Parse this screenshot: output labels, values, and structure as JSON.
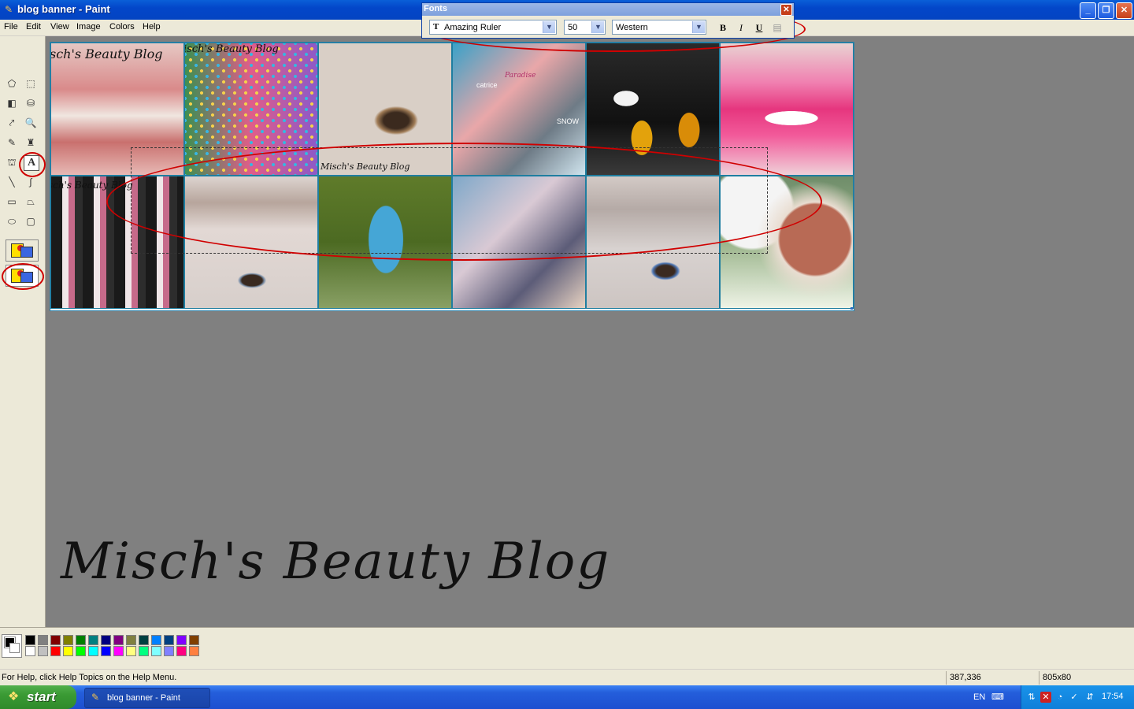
{
  "window": {
    "title": "blog banner - Paint"
  },
  "menu": {
    "file": "File",
    "edit": "Edit",
    "view": "View",
    "image": "Image",
    "colors": "Colors",
    "help": "Help"
  },
  "fonts_toolbar": {
    "title": "Fonts",
    "font_name": "Amazing Ruler",
    "font_size": "50",
    "script": "Western",
    "bold": "B",
    "italic": "I",
    "underline": "U"
  },
  "canvas": {
    "watermark": "Misch's Beauty Blog",
    "watermark_cut_1": "isch's Beauty Blog",
    "watermark_cut_2": "sch's Beauty Blog",
    "tile_labels": [
      "catrice",
      "Paradise",
      "SNOW"
    ],
    "big_text": "Misch's Beauty Blog"
  },
  "palette": {
    "top_row": [
      "#000000",
      "#808080",
      "#800000",
      "#808000",
      "#008000",
      "#008080",
      "#000080",
      "#800080",
      "#808040",
      "#004040",
      "#0080ff",
      "#004080",
      "#8000ff",
      "#804000"
    ],
    "bottom_row": [
      "#ffffff",
      "#c0c0c0",
      "#ff0000",
      "#ffff00",
      "#00ff00",
      "#00ffff",
      "#0000ff",
      "#ff00ff",
      "#ffff80",
      "#00ff80",
      "#80ffff",
      "#8080ff",
      "#ff0080",
      "#ff8040"
    ]
  },
  "status": {
    "help_text": "For Help, click Help Topics on the Help Menu.",
    "coords": "387,336",
    "size": "805x80"
  },
  "taskbar": {
    "start": "start",
    "task_button": "blog banner - Paint",
    "language": "EN",
    "time": "17:54"
  }
}
